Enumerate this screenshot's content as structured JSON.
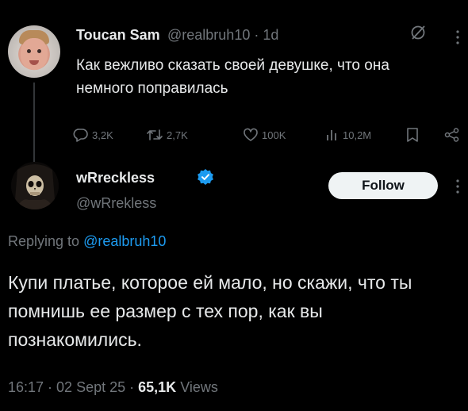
{
  "tweet1": {
    "author_name": "Toucan Sam",
    "handle": "@realbruh10",
    "time": "· 1d",
    "text": "Как вежливо сказать своей девушке, что она немного поправилась",
    "stats": {
      "replies": "3,2K",
      "reposts": "2,7K",
      "likes": "100K",
      "views": "10,2M"
    }
  },
  "tweet2": {
    "author_name": "wRreckless",
    "handle": "@wRrekless",
    "follow_label": "Follow",
    "replying_prefix": "Replying to",
    "replying_handle": "@realbruh10",
    "text": "Купи платье, которое ей мало, но скажи, что ты помнишь ее размер с тех пор, как вы познакомились.",
    "time": "16:17 · 02 Sept 25 ·",
    "views_count": "65,1K",
    "views_label": "Views"
  },
  "colors": {
    "accent": "#1d9bf0",
    "muted": "#71767b",
    "text": "#e7e9ea",
    "background": "#000000"
  }
}
